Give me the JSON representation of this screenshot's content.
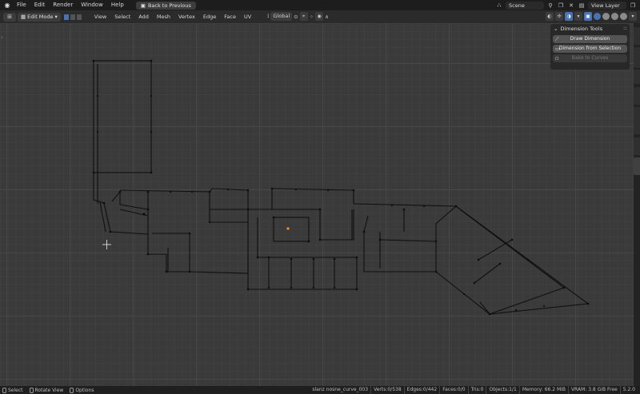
{
  "topbar": {
    "menus": [
      "File",
      "Edit",
      "Render",
      "Window",
      "Help"
    ],
    "back_button": "Back to Previous",
    "scene": "Scene",
    "view_layer": "View Layer"
  },
  "header": {
    "mode": "Edit Mode",
    "menus": [
      "View",
      "Select",
      "Add",
      "Mesh",
      "Vertex",
      "Edge",
      "Face",
      "UV"
    ],
    "orientation": "Global"
  },
  "panel": {
    "title": "Dimension Tools",
    "buttons": [
      "Draw Dimension",
      "Dimension from Selection",
      "Bake to Curves"
    ]
  },
  "statusbar": {
    "select": "Select",
    "rotate": "Rotate View",
    "options": "Options",
    "object": "slanz nosne_curve_003",
    "verts": "Verts:0/538",
    "edges": "Edges:0/442",
    "faces": "Faces:0/0",
    "tris": "Tris:0",
    "objects": "Objects:1/1",
    "memory": "Memory: 66.2 MiB",
    "vram": "VRAM: 3.8 GiB Free",
    "version": "5.2.0"
  },
  "colors": {
    "accent": "#4772b3",
    "origin": "#ff8c1a"
  }
}
